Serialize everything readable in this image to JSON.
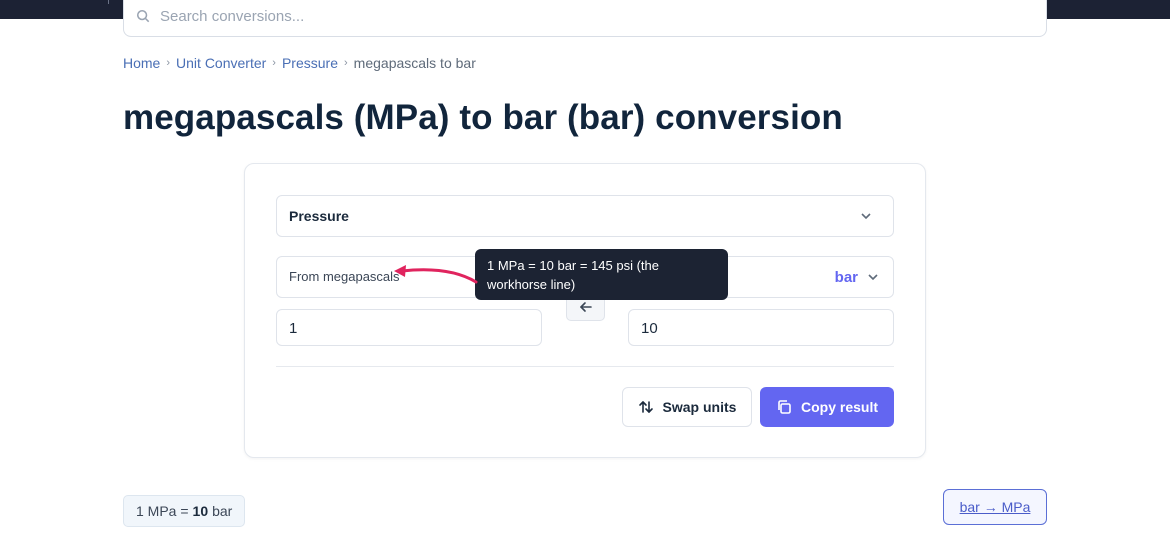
{
  "search": {
    "placeholder": "Search conversions..."
  },
  "breadcrumb": {
    "items": [
      {
        "label": "Home"
      },
      {
        "label": "Unit Converter"
      },
      {
        "label": "Pressure"
      }
    ],
    "current": "megapascals to bar",
    "separator": "›"
  },
  "page": {
    "title": "megapascals (MPa) to bar (bar) conversion"
  },
  "converter": {
    "category": "Pressure",
    "from_unit_label": "From megapascals",
    "to_unit_label": "bar",
    "from_value": "1",
    "to_value": "10",
    "swap_label": "Swap units",
    "copy_label": "Copy result"
  },
  "tooltip": {
    "text": "1 MPa = 10 bar = 145 psi (the workhorse line)"
  },
  "result": {
    "prefix": "1 MPa =",
    "value": "10",
    "unit": "bar"
  },
  "reverse_link": {
    "label": "bar → MPa"
  },
  "colors": {
    "accent": "#6366f1",
    "topbar": "#1c2234",
    "title": "#11253c",
    "annotation_arrow": "#e0245e",
    "link": "#4a6fb5"
  },
  "icons": {
    "search": "search-icon",
    "chevron": "chevron-down-icon",
    "arrow": "arrow-left-icon",
    "swap": "swap-vertical-icon",
    "copy": "copy-icon"
  }
}
